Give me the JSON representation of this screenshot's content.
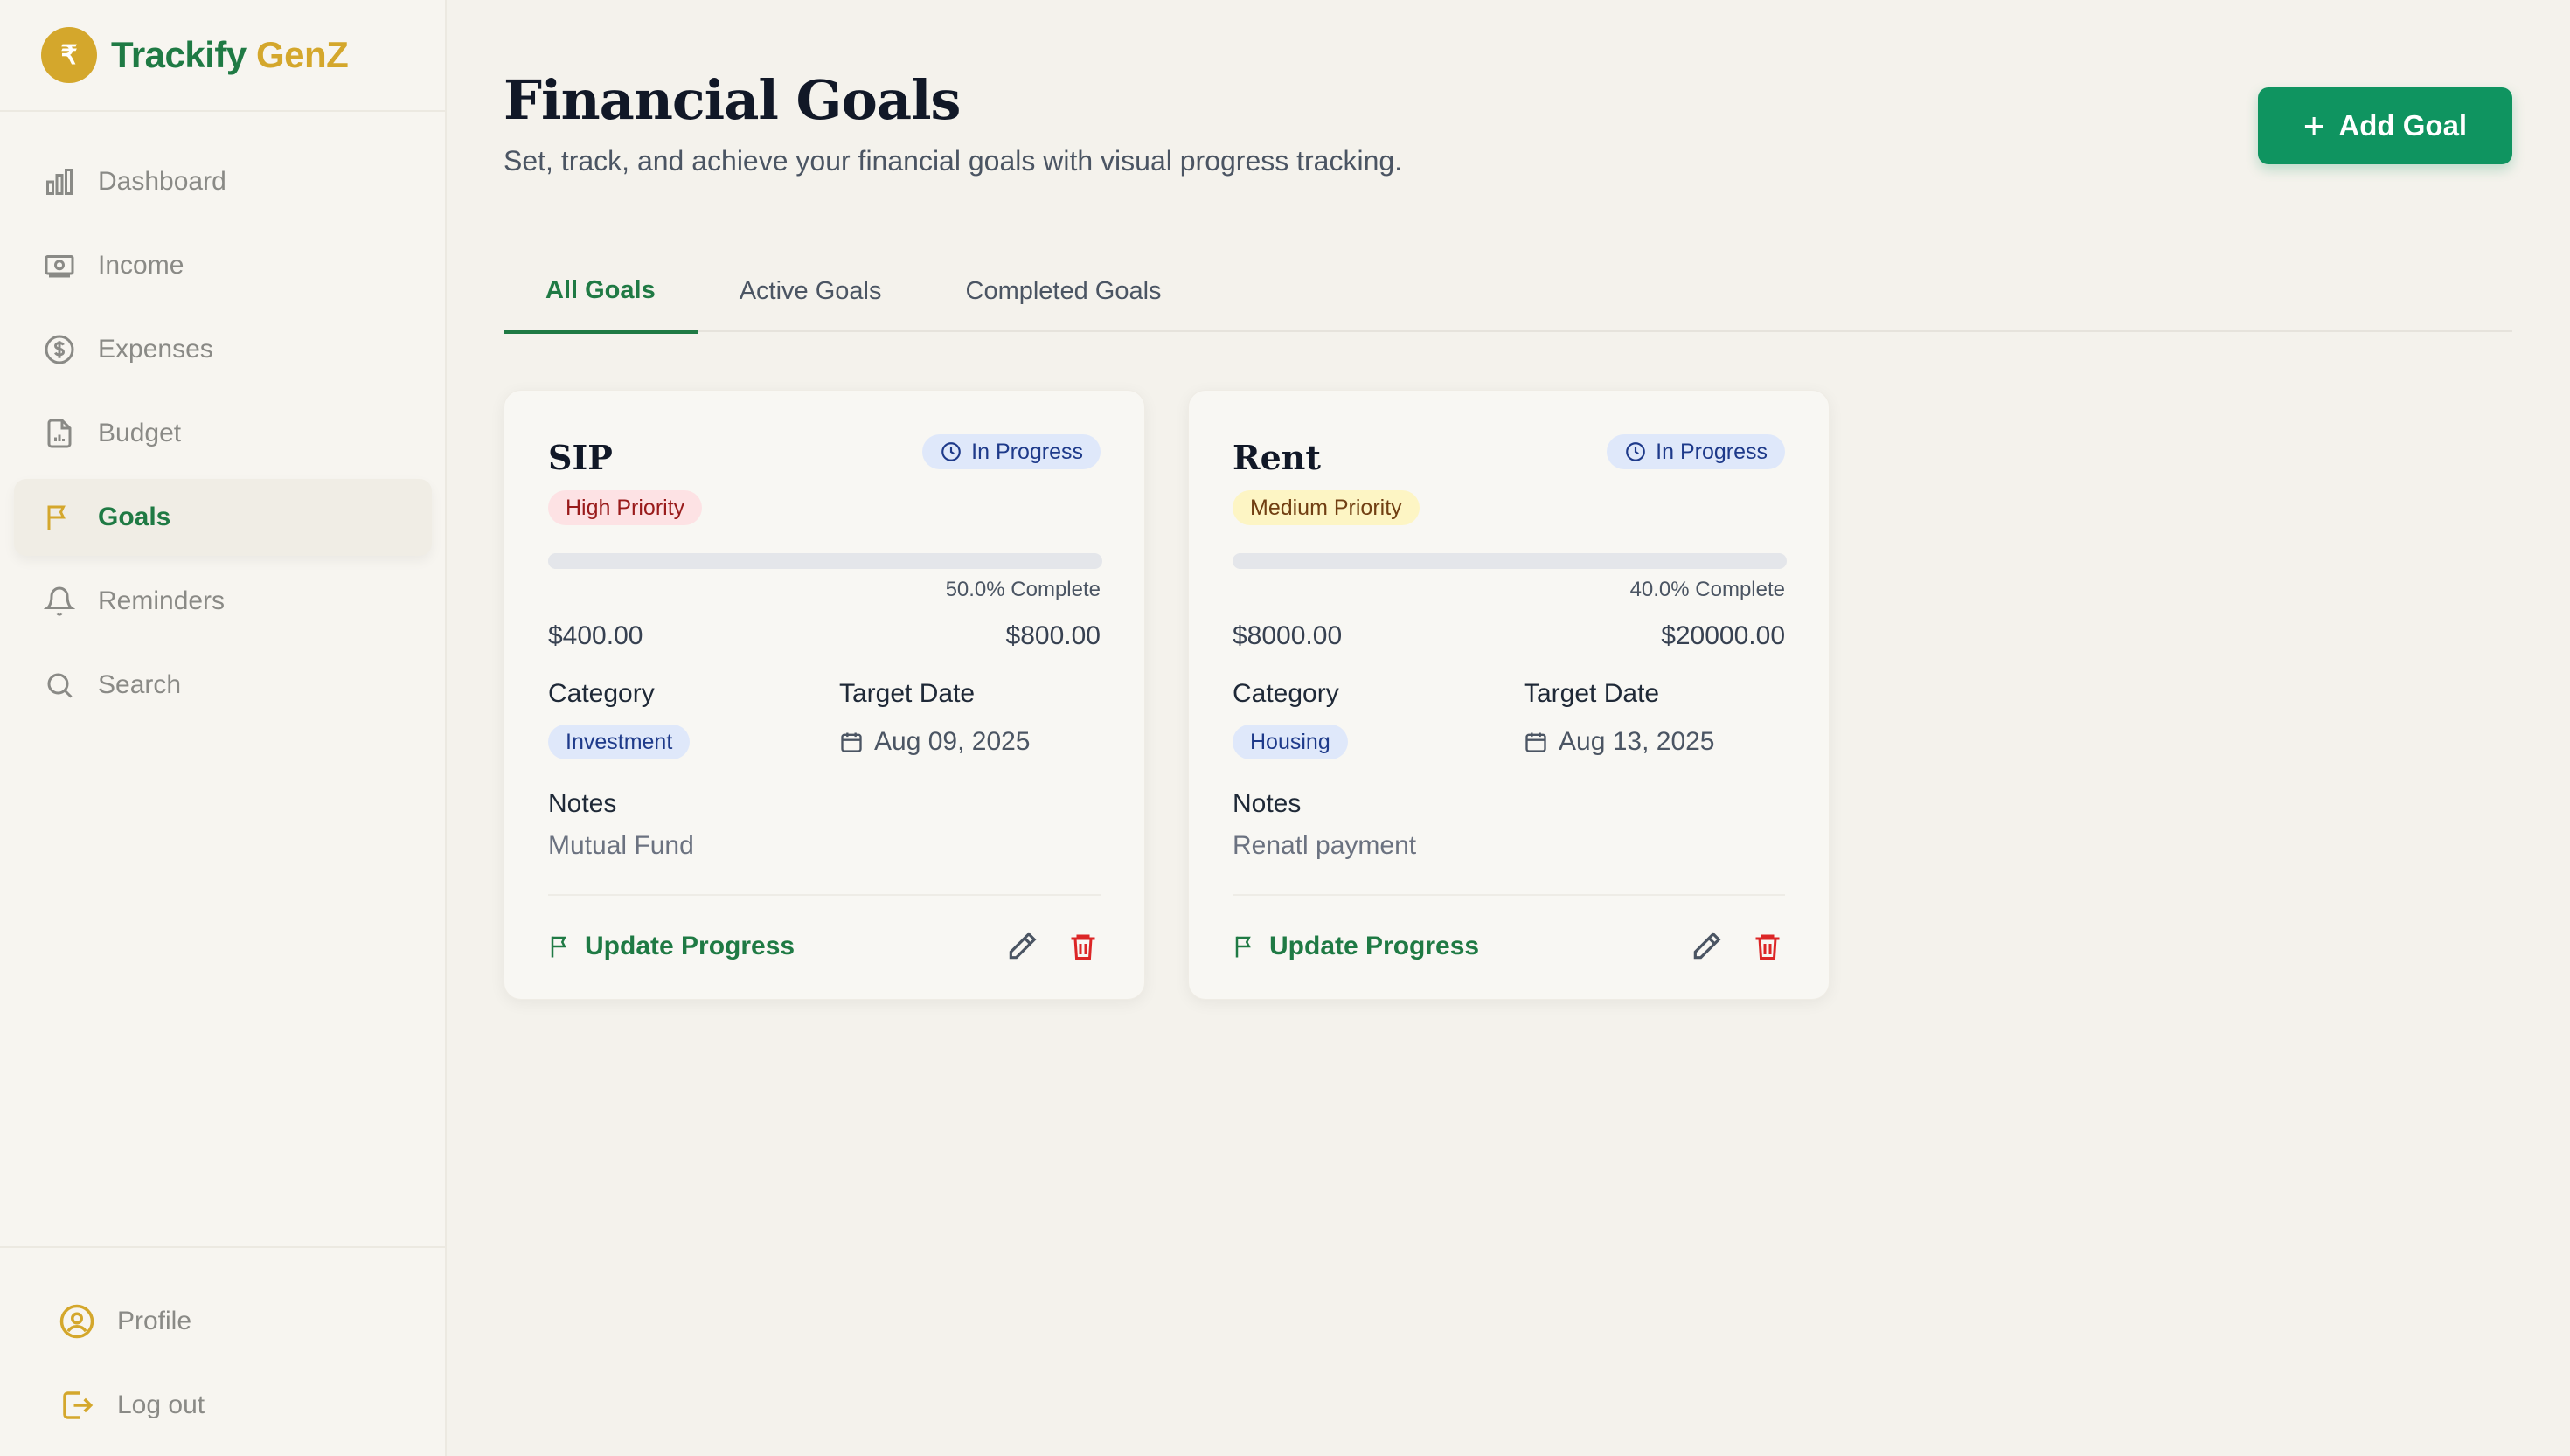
{
  "brand": {
    "logo_symbol": "₹",
    "name_part1": "Trackify",
    "name_part2": "GenZ",
    "colors": {
      "primary": "#1f7a44",
      "accent": "#d4a72c"
    }
  },
  "sidebar": {
    "items": [
      {
        "label": "Dashboard",
        "icon": "bar-chart-icon"
      },
      {
        "label": "Income",
        "icon": "banknote-icon"
      },
      {
        "label": "Expenses",
        "icon": "dollar-circle-icon"
      },
      {
        "label": "Budget",
        "icon": "file-chart-icon"
      },
      {
        "label": "Goals",
        "icon": "flag-icon",
        "active": true
      },
      {
        "label": "Reminders",
        "icon": "bell-icon"
      },
      {
        "label": "Search",
        "icon": "search-icon"
      }
    ],
    "bottom": [
      {
        "label": "Profile",
        "icon": "user-circle-icon"
      },
      {
        "label": "Log out",
        "icon": "logout-icon"
      }
    ]
  },
  "header": {
    "title": "Financial Goals",
    "subtitle": "Set, track, and achieve your financial goals with visual progress tracking.",
    "add_button": "Add Goal"
  },
  "tabs": [
    {
      "label": "All Goals",
      "active": true
    },
    {
      "label": "Active Goals"
    },
    {
      "label": "Completed Goals"
    }
  ],
  "goals": [
    {
      "title": "SIP",
      "status": "In Progress",
      "priority": "High Priority",
      "priority_colors": {
        "bg": "#fde2e4",
        "fg": "#991b1b"
      },
      "progress": 0.5,
      "progress_color": "#e4e6ea",
      "progress_text": "50.0% Complete",
      "current": "$400.00",
      "target": "$800.00",
      "category_label": "Category",
      "category": "Investment",
      "date_label": "Target Date",
      "date": "Aug 09, 2025",
      "notes_label": "Notes",
      "notes": "Mutual Fund",
      "update_label": "Update Progress"
    },
    {
      "title": "Rent",
      "status": "In Progress",
      "priority": "Medium Priority",
      "priority_colors": {
        "bg": "#fdf5c4",
        "fg": "#713f12"
      },
      "progress": 0.4,
      "progress_color": "#e4e6ea",
      "progress_text": "40.0% Complete",
      "current": "$8000.00",
      "target": "$20000.00",
      "category_label": "Category",
      "category": "Housing",
      "date_label": "Target Date",
      "date": "Aug 13, 2025",
      "notes_label": "Notes",
      "notes": "Renatl payment",
      "update_label": "Update Progress"
    }
  ]
}
